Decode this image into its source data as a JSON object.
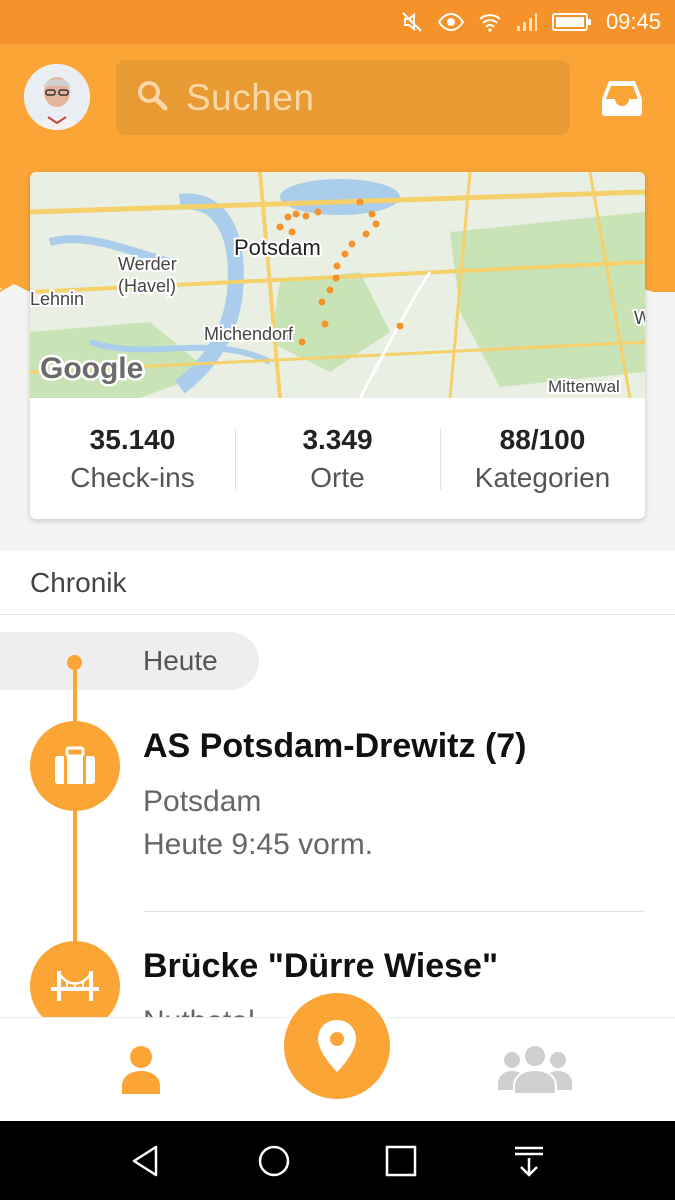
{
  "status_bar": {
    "time": "09:45"
  },
  "header": {
    "search_placeholder": "Suchen",
    "colors": {
      "brand": "#fba537",
      "status_bar": "#f6922a",
      "search_bg": "#e89a33"
    }
  },
  "map": {
    "labels": [
      "Potsdam",
      "Werder",
      "(Havel)",
      "Lehnin",
      "Michendorf",
      "Mittenwal",
      "W"
    ],
    "logo": "Google"
  },
  "stats": [
    {
      "value": "35.140",
      "label": "Check-ins"
    },
    {
      "value": "3.349",
      "label": "Orte"
    },
    {
      "value": "88/100",
      "label": "Kategorien"
    }
  ],
  "chronik": {
    "title": "Chronik",
    "day_label": "Heute",
    "items": [
      {
        "title": "AS Potsdam-Drewitz (7)",
        "city": "Potsdam",
        "time": "Heute 9:45 vorm.",
        "icon": "suitcase-icon"
      },
      {
        "title": "Brücke \"Dürre Wiese\"",
        "city": "Nuthetal",
        "icon": "bridge-icon"
      }
    ]
  },
  "bottom_nav": {
    "items": [
      "profile-icon",
      "checkin-pin-icon",
      "friends-icon"
    ]
  },
  "system_nav": {
    "items": [
      "back-icon",
      "home-icon",
      "recents-icon",
      "notification-pull-icon"
    ]
  }
}
